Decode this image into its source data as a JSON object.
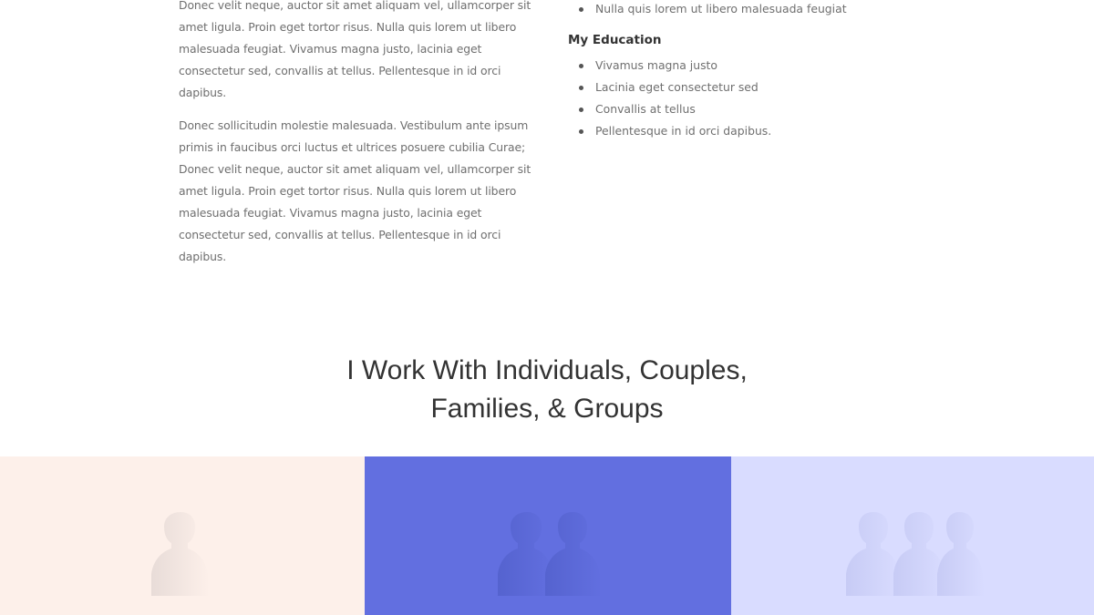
{
  "about": {
    "paragraphs": [
      "Donec velit neque, auctor sit amet aliquam vel, ullamcorper sit amet ligula. Proin eget tortor risus. Nulla quis lorem ut libero malesuada feugiat. Vivamus magna justo, lacinia eget consectetur sed, convallis at tellus. Pellentesque in id orci dapibus.",
      "Donec sollicitudin molestie malesuada. Vestibulum ante ipsum primis in faucibus orci luctus et ultrices posuere cubilia Curae; Donec velit neque, auctor sit amet aliquam vel, ullamcorper sit amet ligula. Proin eget tortor risus. Nulla quis lorem ut libero malesuada feugiat. Vivamus magna justo, lacinia eget consectetur sed, convallis at tellus. Pellentesque in id orci dapibus."
    ]
  },
  "skills": {
    "items": [
      "Nulla quis lorem ut libero malesuada feugiat"
    ]
  },
  "education": {
    "heading": "My Education",
    "items": [
      "Vivamus magna justo",
      "Lacinia eget consectetur sed",
      "Convallis at tellus",
      "Pellentesque in id orci dapibus."
    ]
  },
  "work_with": {
    "title_line_1": "I Work With Individuals, Couples,",
    "title_line_2": "Families, & Groups"
  },
  "tiles": [
    {
      "icon": "individual-icon",
      "background": "#fdf0ea"
    },
    {
      "icon": "couple-icon",
      "background": "#626fe0"
    },
    {
      "icon": "group-icon",
      "background": "#d9dcff"
    }
  ],
  "colors": {
    "body_text": "#6f6f6f",
    "heading_text": "#333333"
  }
}
